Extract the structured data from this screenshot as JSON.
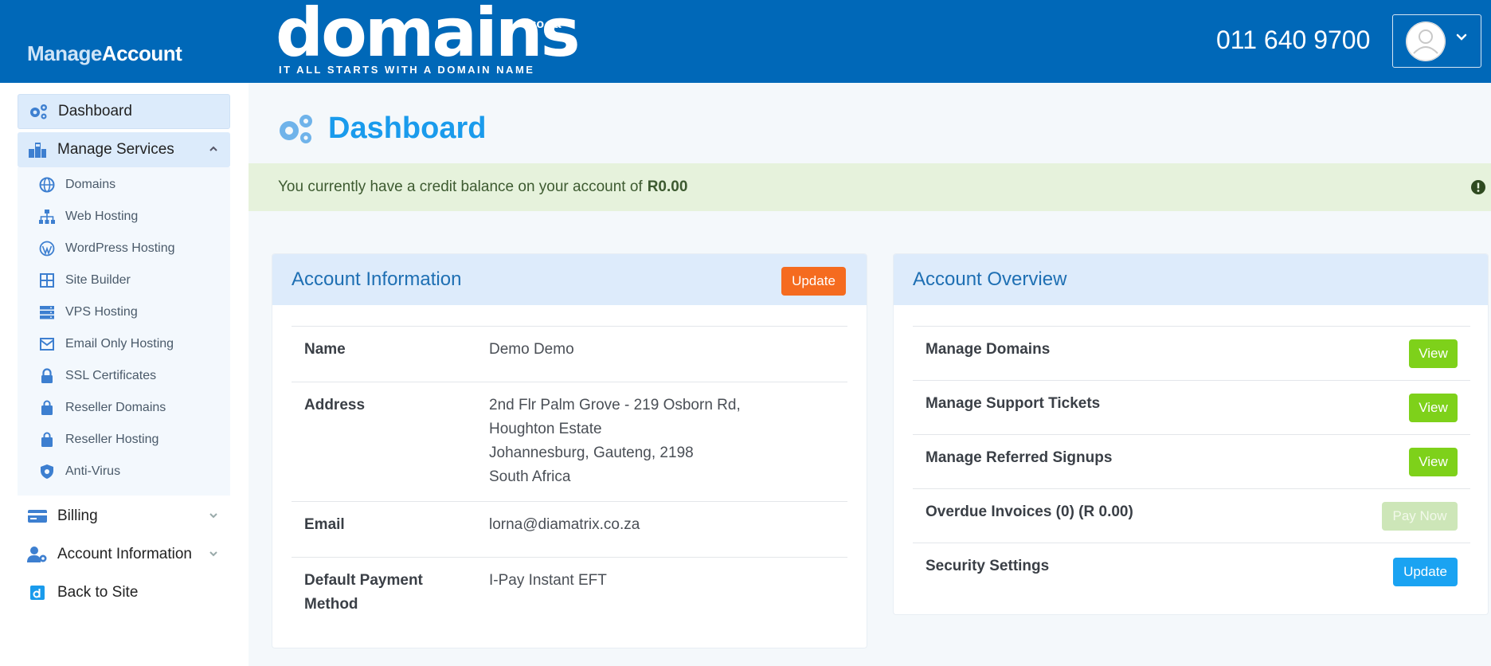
{
  "header": {
    "brand_manage": "Manage",
    "brand_account": "Account",
    "logo_word": "domains",
    "logo_tld": ".co.za",
    "logo_tagline": "IT ALL STARTS WITH A DOMAIN NAME",
    "phone": "011 640 9700"
  },
  "sidebar": {
    "dashboard": "Dashboard",
    "manage_services": "Manage Services",
    "sub_items": [
      "Domains",
      "Web Hosting",
      "WordPress Hosting",
      "Site Builder",
      "VPS Hosting",
      "Email Only Hosting",
      "SSL Certificates",
      "Reseller Domains",
      "Reseller Hosting",
      "Anti-Virus"
    ],
    "billing": "Billing",
    "account_information": "Account Information",
    "back_to_site": "Back to Site"
  },
  "main": {
    "title": "Dashboard",
    "alert_text": "You currently have a credit balance on your account of",
    "alert_amount": "R0.00"
  },
  "account_info": {
    "title": "Account Information",
    "update_label": "Update",
    "name_label": "Name",
    "name_value": "Demo Demo",
    "address_label": "Address",
    "address_lines": [
      "2nd Flr Palm Grove - 219 Osborn Rd,",
      "Houghton Estate",
      "Johannesburg, Gauteng, 2198",
      "South Africa"
    ],
    "email_label": "Email",
    "email_value": "lorna@diamatrix.co.za",
    "payment_label_1": "Default Payment",
    "payment_label_2": "Method",
    "payment_value": "I-Pay Instant EFT"
  },
  "overview": {
    "title": "Account Overview",
    "rows": [
      {
        "label": "Manage Domains",
        "button": "View"
      },
      {
        "label": "Manage Support Tickets",
        "button": "View"
      },
      {
        "label": "Manage Referred Signups",
        "button": "View"
      },
      {
        "label": "Overdue Invoices (0) (R 0.00)",
        "button": "Pay Now"
      },
      {
        "label": "Security Settings",
        "button": "Update"
      }
    ]
  },
  "colors": {
    "header_bg": "#0068b8",
    "title_blue": "#1a9bec",
    "orange": "#f56b1f",
    "green": "#7ed11a",
    "blue_button": "#1aa3f2"
  }
}
